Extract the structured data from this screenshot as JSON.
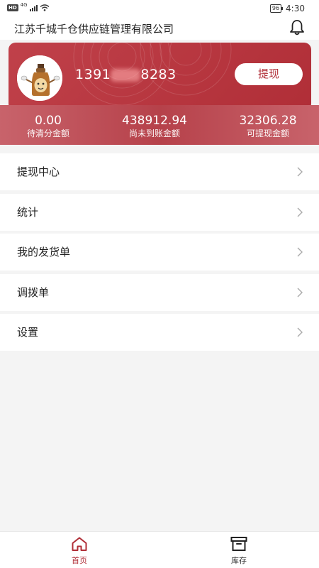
{
  "status_bar": {
    "hd": "HD",
    "network": "4G",
    "battery": "96",
    "time": "4:30"
  },
  "header": {
    "company_name": "江苏千城千仓供应链管理有限公司",
    "bell_icon": "bell-icon"
  },
  "account": {
    "phone_prefix": "1391",
    "phone_suffix": "8283",
    "withdraw_button": "提现"
  },
  "stats": [
    {
      "value": "0.00",
      "label": "待清分金额"
    },
    {
      "value": "438912.94",
      "label": "尚未到账金额"
    },
    {
      "value": "32306.28",
      "label": "可提现金额"
    }
  ],
  "menu": [
    {
      "label": "提现中心"
    },
    {
      "label": "统计"
    },
    {
      "label": "我的发货单"
    },
    {
      "label": "调拨单"
    },
    {
      "label": "设置"
    }
  ],
  "tabbar": {
    "home": "首页",
    "stock": "库存",
    "active": "home"
  },
  "colors": {
    "brand_red": "#b02e37",
    "card_red": "#c0414a"
  }
}
